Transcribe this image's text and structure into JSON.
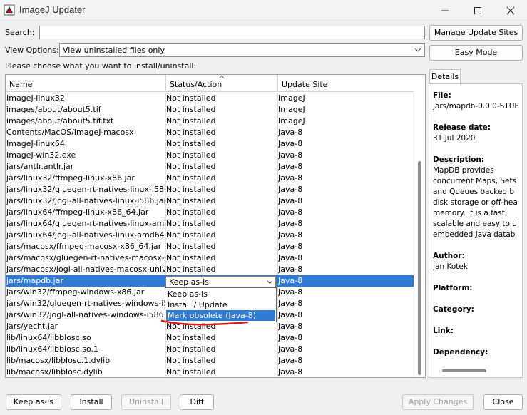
{
  "window": {
    "title": "ImageJ Updater"
  },
  "search": {
    "label": "Search:",
    "value": ""
  },
  "view_options": {
    "label": "View Options:",
    "selected": "View uninstalled files only"
  },
  "instruction": "Please choose what you want to install/uninstall:",
  "table": {
    "columns": [
      "Name",
      "Status/Action",
      "Update Site"
    ],
    "rows": [
      {
        "name": "ImageJ-linux32",
        "status": "Not installed",
        "site": "ImageJ"
      },
      {
        "name": "images/about/about5.tif",
        "status": "Not installed",
        "site": "ImageJ"
      },
      {
        "name": "images/about/about5.tif.txt",
        "status": "Not installed",
        "site": "ImageJ"
      },
      {
        "name": "Contents/MacOS/ImageJ-macosx",
        "status": "Not installed",
        "site": "Java-8"
      },
      {
        "name": "ImageJ-linux64",
        "status": "Not installed",
        "site": "Java-8"
      },
      {
        "name": "ImageJ-win32.exe",
        "status": "Not installed",
        "site": "Java-8"
      },
      {
        "name": "jars/antlr.antlr.jar",
        "status": "Not installed",
        "site": "Java-8"
      },
      {
        "name": "jars/linux32/ffmpeg-linux-x86.jar",
        "status": "Not installed",
        "site": "Java-8"
      },
      {
        "name": "jars/linux32/gluegen-rt-natives-linux-i586.jar",
        "status": "Not installed",
        "site": "Java-8"
      },
      {
        "name": "jars/linux32/jogl-all-natives-linux-i586.jar",
        "status": "Not installed",
        "site": "Java-8"
      },
      {
        "name": "jars/linux64/ffmpeg-linux-x86_64.jar",
        "status": "Not installed",
        "site": "Java-8"
      },
      {
        "name": "jars/linux64/gluegen-rt-natives-linux-amd6...",
        "status": "Not installed",
        "site": "Java-8"
      },
      {
        "name": "jars/linux64/jogl-all-natives-linux-amd64.jar",
        "status": "Not installed",
        "site": "Java-8"
      },
      {
        "name": "jars/macosx/ffmpeg-macosx-x86_64.jar",
        "status": "Not installed",
        "site": "Java-8"
      },
      {
        "name": "jars/macosx/gluegen-rt-natives-macosx-uni...",
        "status": "Not installed",
        "site": "Java-8"
      },
      {
        "name": "jars/macosx/jogl-all-natives-macosx-univer...",
        "status": "Not installed",
        "site": "Java-8"
      },
      {
        "name": "jars/mapdb.jar",
        "status": "Keep as-is",
        "site": "Java-8"
      },
      {
        "name": "jars/win32/ffmpeg-windows-x86.jar",
        "status": "",
        "site": "Java-8"
      },
      {
        "name": "jars/win32/gluegen-rt-natives-windows-i58...",
        "status": "",
        "site": "Java-8"
      },
      {
        "name": "jars/win32/jogl-all-natives-windows-i586.jar",
        "status": "",
        "site": "Java-8"
      },
      {
        "name": "jars/yecht.jar",
        "status": "Not installed",
        "site": "Java-8"
      },
      {
        "name": "lib/linux64/libblosc.so",
        "status": "Not installed",
        "site": "Java-8"
      },
      {
        "name": "lib/linux64/libblosc.so.1",
        "status": "Not installed",
        "site": "Java-8"
      },
      {
        "name": "lib/macosx/libblosc.1.dylib",
        "status": "Not installed",
        "site": "Java-8"
      },
      {
        "name": "lib/macosx/libblosc.dylib",
        "status": "Not installed",
        "site": "Java-8"
      }
    ],
    "selected_row": 16
  },
  "status_dropdown": {
    "value": "Keep as-is",
    "options": [
      "Keep as-is",
      "Install / Update",
      "Mark obsolete (Java-8)"
    ],
    "highlighted": 2
  },
  "right_panel": {
    "manage_sites_button": "Manage Update Sites",
    "easy_mode_button": "Easy Mode",
    "details_tab": "Details",
    "details": {
      "file_label": "File:",
      "file_value": "jars/mapdb-0.0.0-STUB",
      "release_label": "Release date:",
      "release_value": "31 Jul 2020",
      "description_label": "Description:",
      "description_lines": [
        "MapDB provides",
        "concurrent Maps, Sets",
        "and Queues backed b",
        "disk storage or off-hea",
        "memory. It is a fast,",
        "scalable and easy to u",
        "embedded Java datab"
      ],
      "author_label": "Author:",
      "author_value": "Jan Kotek",
      "platform_label": "Platform:",
      "category_label": "Category:",
      "link_label": "Link:",
      "dependency_label": "Dependency:"
    }
  },
  "bottom_buttons": {
    "keep": "Keep as-is",
    "install": "Install",
    "uninstall": "Uninstall",
    "diff": "Diff",
    "apply": "Apply Changes",
    "close": "Close"
  },
  "colors": {
    "selection": "#2f7bd6",
    "annotation": "#d81b1b"
  }
}
